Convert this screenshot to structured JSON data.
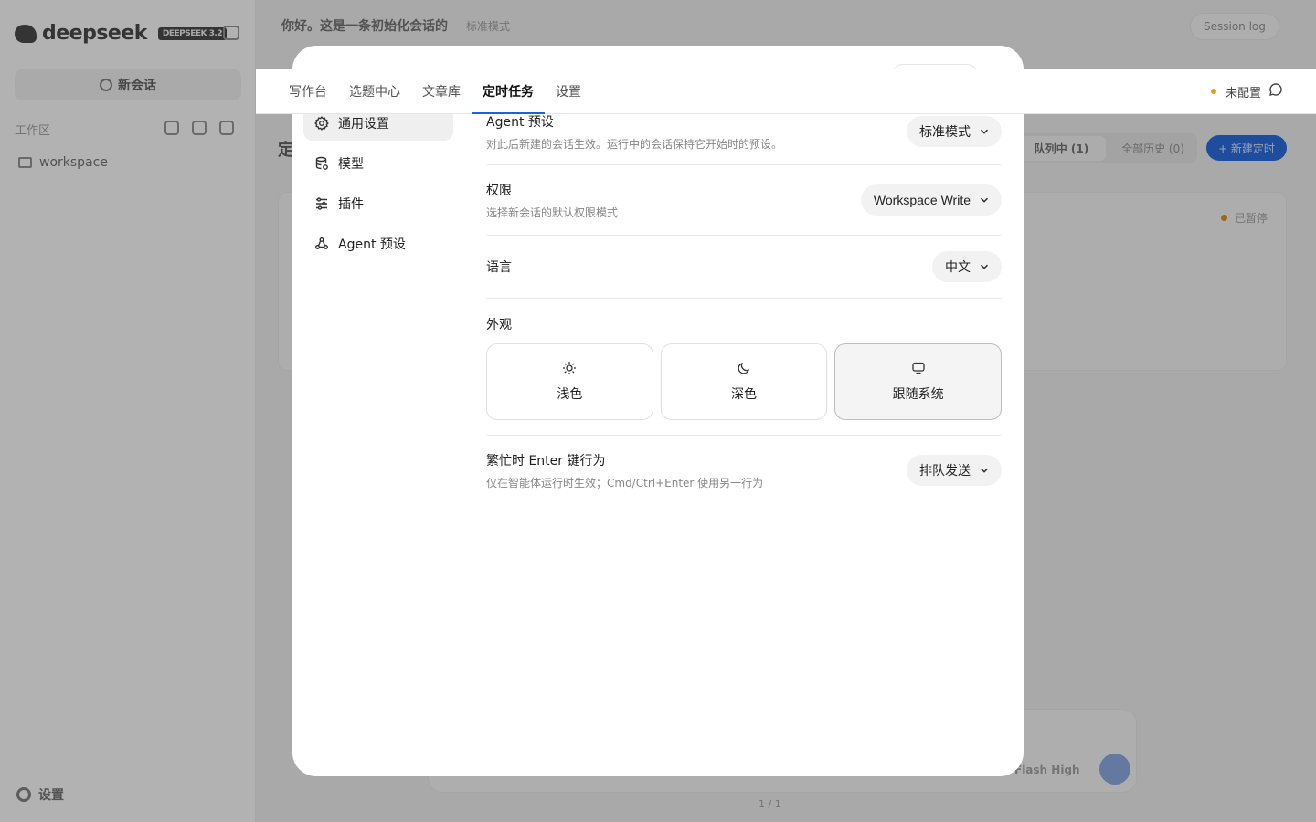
{
  "background": {
    "logo": {
      "name": "deepseek",
      "badge": "DEEPSEEK 3.2"
    },
    "new_chat_label": "新会话",
    "workspace_label": "工作区",
    "workspace_item": "workspace",
    "settings_label": "设置",
    "chat_title": "你好。这是一条初始化会话的",
    "mode_label": "标准模式",
    "session_log_label": "Session log",
    "section_heading": "定",
    "filter_tabs": [
      "队列中 (1)",
      "全部历史 (0)"
    ],
    "new_task_label": "+ 新建定时",
    "card_status": "已暂停",
    "model_label": "Flash High",
    "pager": "1 / 1"
  },
  "tabbar": {
    "tabs": [
      "写作台",
      "选题中心",
      "文章库",
      "定时任务",
      "设置"
    ],
    "active_tab_index": 3,
    "status_text": "未配置",
    "status_color": "#f29a0e",
    "accent_color": "#1f5fe0"
  },
  "settings_modal": {
    "nav": [
      {
        "label": "通用设置",
        "icon": "gear-icon",
        "active": true
      },
      {
        "label": "模型",
        "icon": "database-icon",
        "active": false
      },
      {
        "label": "插件",
        "icon": "sliders-icon",
        "active": false
      },
      {
        "label": "Agent 预设",
        "icon": "recycle-icon",
        "active": false
      }
    ],
    "agent_preset": {
      "title": "Agent 预设",
      "desc": "对此后新建的会话生效。运行中的会话保持它开始时的预设。",
      "value": "标准模式"
    },
    "permission": {
      "title": "权限",
      "desc": "选择新会话的默认权限模式",
      "value": "Workspace Write"
    },
    "language": {
      "title": "语言",
      "value": "中文"
    },
    "appearance": {
      "title": "外观",
      "options": [
        {
          "label": "浅色",
          "icon": "sun-icon"
        },
        {
          "label": "深色",
          "icon": "moon-icon"
        },
        {
          "label": "跟随系统",
          "icon": "monitor-icon"
        }
      ],
      "selected_index": 2
    },
    "busy_enter": {
      "title": "繁忙时 Enter 键行为",
      "desc": "仅在智能体运行时生效；Cmd/Ctrl+Enter 使用另一行为",
      "value": "排队发送"
    }
  }
}
